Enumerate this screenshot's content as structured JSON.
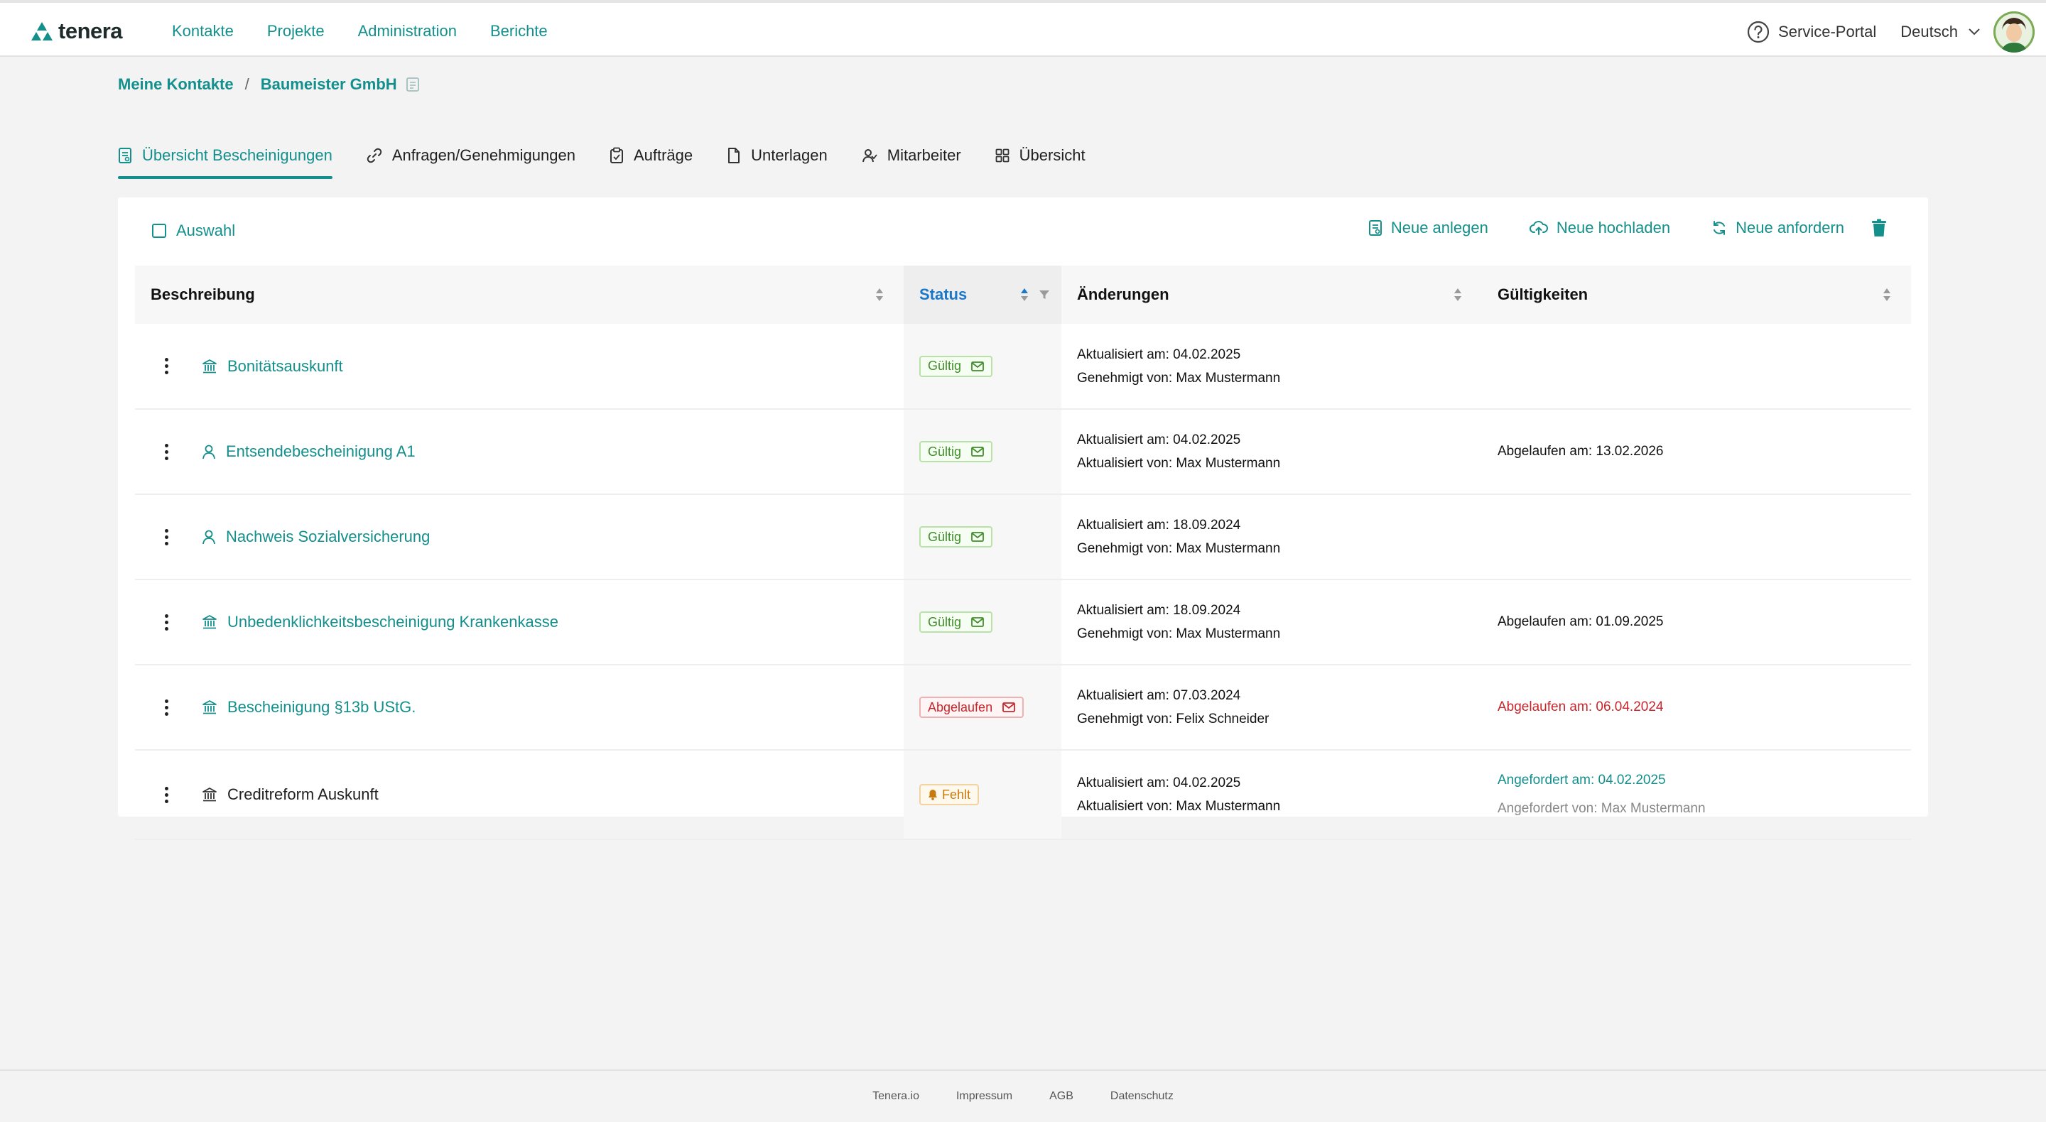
{
  "brand": {
    "name": "tenera",
    "color": "#138f8c"
  },
  "nav": [
    "Kontakte",
    "Projekte",
    "Administration",
    "Berichte"
  ],
  "header": {
    "service_portal": "Service-Portal",
    "language": "Deutsch"
  },
  "breadcrumb": {
    "root": "Meine Kontakte",
    "sep": "/",
    "current": "Baumeister GmbH"
  },
  "tabs": [
    {
      "label": "Übersicht Besche inigungen",
      "icon": "certificate-icon"
    },
    {
      "label": "Anfragen/Genehmigungen",
      "icon": "link-icon"
    },
    {
      "label": "Aufträge",
      "icon": "clipboard-icon"
    },
    {
      "label": "Unterlagen",
      "icon": "document-icon"
    },
    {
      "label": "Mitarbeiter",
      "icon": "people-icon"
    },
    {
      "label": "Übersicht",
      "icon": "grid-icon"
    }
  ],
  "toolbar": {
    "select_all": "Auswahl",
    "new_create": "Neue anlegen",
    "new_upload": "Neue hochladen",
    "new_request": "Neue anfordern"
  },
  "table": {
    "headers": [
      "Beschreibung",
      "Status",
      "Änderungen",
      "Gültigkeiten"
    ],
    "rows": [
      {
        "name": "Bonitätsauskunft",
        "icon": "bank-icon",
        "status": "Gültig",
        "status_type": "ok",
        "changes": [
          "Aktualisiert am: 04.02.2025",
          "Genehmigt von: Max Mustermann"
        ],
        "validity": []
      },
      {
        "name": "Entsendebescheinigung A1",
        "icon": "person-icon",
        "status": "Gültig",
        "status_type": "ok",
        "changes": [
          "Aktualisiert am: 04.02.2025",
          "Aktualisiert von: Max Mustermann"
        ],
        "validity": [
          "Abgelaufen am: 13.02.2026"
        ]
      },
      {
        "name": "Nachweis Sozialversicherung",
        "icon": "person-icon",
        "status": "Gültig",
        "status_type": "ok",
        "changes": [
          "Aktualisiert am: 18.09.2024",
          "Genehmigt von: Max Mustermann"
        ],
        "validity": []
      },
      {
        "name": "Unbedenklichkeitsbescheinigung Krankenkasse",
        "icon": "bank-icon",
        "status": "Gültig",
        "status_type": "ok",
        "changes": [
          "Aktualisiert am: 18.09.2024",
          "Genehmigt von: Max Mustermann"
        ],
        "validity": [
          "Abgelaufen am: 01.09.2025"
        ]
      },
      {
        "name": "Bescheinigung §13b UStG.",
        "icon": "bank-icon",
        "status": "Abgelaufen",
        "status_type": "exp",
        "changes": [
          "Aktualisiert am: 07.03.2024",
          "Genehmigt von: Felix Schneider"
        ],
        "validity": [
          "Abgelaufen am: 06.04.2024"
        ]
      },
      {
        "name": "Creditreform Auskunft",
        "icon": "bank-icon",
        "status": "Fehlt",
        "status_type": "miss",
        "changes": [
          "Aktualisiert am: 04.02.2025",
          "Aktualisiert von: Max Mustermann"
        ],
        "validity": [
          "Angefordert am: 04.02.2025",
          "Angefordert von: Max Mustermann"
        ]
      }
    ]
  },
  "footer": [
    "Tenera.io",
    "Impressum",
    "AGB",
    "Datenschutz"
  ]
}
